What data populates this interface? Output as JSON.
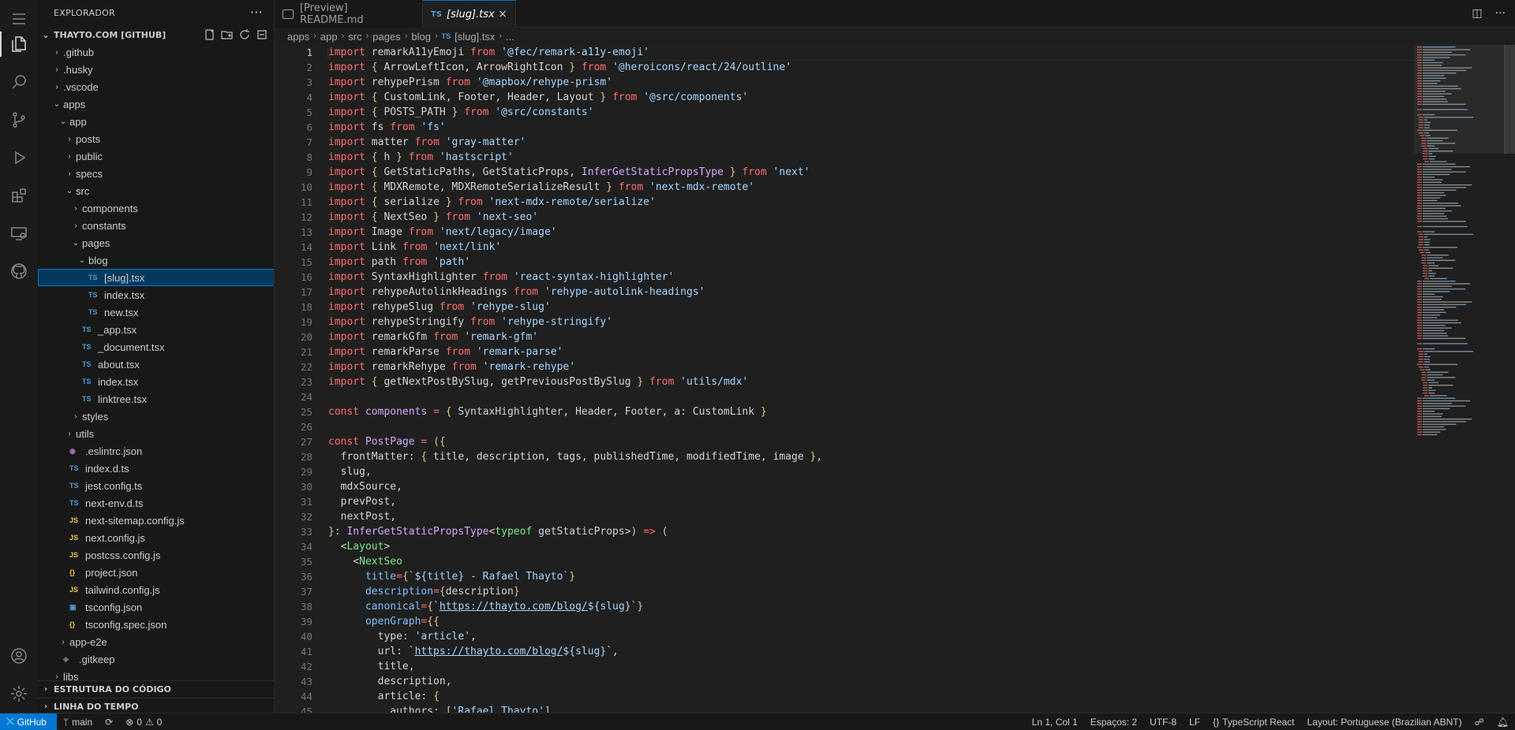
{
  "sidebar": {
    "title": "EXPLORADOR",
    "more": "···",
    "root": "THAYTO.COM [GITHUB]",
    "tree": [
      {
        "label": ".github",
        "depth": 1,
        "kind": "folder",
        "open": false
      },
      {
        "label": ".husky",
        "depth": 1,
        "kind": "folder",
        "open": false
      },
      {
        "label": ".vscode",
        "depth": 1,
        "kind": "folder",
        "open": false
      },
      {
        "label": "apps",
        "depth": 1,
        "kind": "folder",
        "open": true
      },
      {
        "label": "app",
        "depth": 2,
        "kind": "folder",
        "open": true
      },
      {
        "label": "posts",
        "depth": 3,
        "kind": "folder",
        "open": false
      },
      {
        "label": "public",
        "depth": 3,
        "kind": "folder",
        "open": false
      },
      {
        "label": "specs",
        "depth": 3,
        "kind": "folder",
        "open": false
      },
      {
        "label": "src",
        "depth": 3,
        "kind": "folder",
        "open": true
      },
      {
        "label": "components",
        "depth": 4,
        "kind": "folder",
        "open": false
      },
      {
        "label": "constants",
        "depth": 4,
        "kind": "folder",
        "open": false
      },
      {
        "label": "pages",
        "depth": 4,
        "kind": "folder",
        "open": true
      },
      {
        "label": "blog",
        "depth": 5,
        "kind": "folder",
        "open": true
      },
      {
        "label": "[slug].tsx",
        "depth": 6,
        "kind": "ts",
        "selected": true
      },
      {
        "label": "index.tsx",
        "depth": 6,
        "kind": "ts"
      },
      {
        "label": "new.tsx",
        "depth": 6,
        "kind": "ts"
      },
      {
        "label": "_app.tsx",
        "depth": 5,
        "kind": "ts"
      },
      {
        "label": "_document.tsx",
        "depth": 5,
        "kind": "ts"
      },
      {
        "label": "about.tsx",
        "depth": 5,
        "kind": "ts"
      },
      {
        "label": "index.tsx",
        "depth": 5,
        "kind": "ts"
      },
      {
        "label": "linktree.tsx",
        "depth": 5,
        "kind": "ts"
      },
      {
        "label": "styles",
        "depth": 4,
        "kind": "folder",
        "open": false
      },
      {
        "label": "utils",
        "depth": 3,
        "kind": "folder",
        "open": false
      },
      {
        "label": ".eslintrc.json",
        "depth": 3,
        "kind": "eslint"
      },
      {
        "label": "index.d.ts",
        "depth": 3,
        "kind": "ts"
      },
      {
        "label": "jest.config.ts",
        "depth": 3,
        "kind": "ts"
      },
      {
        "label": "next-env.d.ts",
        "depth": 3,
        "kind": "ts"
      },
      {
        "label": "next-sitemap.config.js",
        "depth": 3,
        "kind": "js"
      },
      {
        "label": "next.config.js",
        "depth": 3,
        "kind": "js"
      },
      {
        "label": "postcss.config.js",
        "depth": 3,
        "kind": "js"
      },
      {
        "label": "project.json",
        "depth": 3,
        "kind": "json"
      },
      {
        "label": "tailwind.config.js",
        "depth": 3,
        "kind": "js"
      },
      {
        "label": "tsconfig.json",
        "depth": 3,
        "kind": "tsconfig"
      },
      {
        "label": "tsconfig.spec.json",
        "depth": 3,
        "kind": "json"
      },
      {
        "label": "app-e2e",
        "depth": 2,
        "kind": "folder",
        "open": false
      },
      {
        "label": ".gitkeep",
        "depth": 2,
        "kind": "gitkeep"
      },
      {
        "label": "libs",
        "depth": 1,
        "kind": "folder",
        "open": false
      }
    ],
    "sections": [
      "ESTRUTURA DO CÓDIGO",
      "LINHA DO TEMPO"
    ]
  },
  "tabs": [
    {
      "label": "[Preview] README.md",
      "active": false
    },
    {
      "label": "[slug].tsx",
      "active": true,
      "badge": "TS"
    }
  ],
  "breadcrumb": [
    "apps",
    "app",
    "src",
    "pages",
    "blog",
    "[slug].tsx",
    "..."
  ],
  "editor": {
    "current_line": 1,
    "lines": [
      "import remarkA11yEmoji from '@fec/remark-a11y-emoji'",
      "import { ArrowLeftIcon, ArrowRightIcon } from '@heroicons/react/24/outline'",
      "import rehypePrism from '@mapbox/rehype-prism'",
      "import { CustomLink, Footer, Header, Layout } from '@src/components'",
      "import { POSTS_PATH } from '@src/constants'",
      "import fs from 'fs'",
      "import matter from 'gray-matter'",
      "import { h } from 'hastscript'",
      "import { GetStaticPaths, GetStaticProps, InferGetStaticPropsType } from 'next'",
      "import { MDXRemote, MDXRemoteSerializeResult } from 'next-mdx-remote'",
      "import { serialize } from 'next-mdx-remote/serialize'",
      "import { NextSeo } from 'next-seo'",
      "import Image from 'next/legacy/image'",
      "import Link from 'next/link'",
      "import path from 'path'",
      "import SyntaxHighlighter from 'react-syntax-highlighter'",
      "import rehypeAutolinkHeadings from 'rehype-autolink-headings'",
      "import rehypeSlug from 'rehype-slug'",
      "import rehypeStringify from 'rehype-stringify'",
      "import remarkGfm from 'remark-gfm'",
      "import remarkParse from 'remark-parse'",
      "import remarkRehype from 'remark-rehype'",
      "import { getNextPostBySlug, getPreviousPostBySlug } from 'utils/mdx'",
      "",
      "const components = { SyntaxHighlighter, Header, Footer, a: CustomLink }",
      "",
      "const PostPage = ({",
      "  frontMatter: { title, description, tags, publishedTime, modifiedTime, image },",
      "  slug,",
      "  mdxSource,",
      "  prevPost,",
      "  nextPost,",
      "}: InferGetStaticPropsType<typeof getStaticProps>) => (",
      "  <Layout>",
      "    <NextSeo",
      "      title={`${title} - Rafael Thayto`}",
      "      description={description}",
      "      canonical={`https://thayto.com/blog/${slug}`}",
      "      openGraph={{",
      "        type: 'article',",
      "        url: `https://thayto.com/blog/${slug}`,",
      "        title,",
      "        description,",
      "        article: {",
      "          authors: ['Rafael Thayto'],"
    ]
  },
  "status": {
    "remote": "GitHub",
    "branch": "main",
    "errors": "0",
    "warnings": "0",
    "position": "Ln 1, Col 1",
    "spaces": "Espaços: 2",
    "encoding": "UTF-8",
    "eol": "LF",
    "language": "TypeScript React",
    "layout": "Layout: Portuguese (Brazilian ABNT)"
  },
  "colors": {
    "accent": "#0078d4",
    "keyword": "#ff6e6e",
    "string": "#a5d6ff",
    "ts_icon": "#4d9bd6",
    "js_icon": "#e8c94b"
  }
}
